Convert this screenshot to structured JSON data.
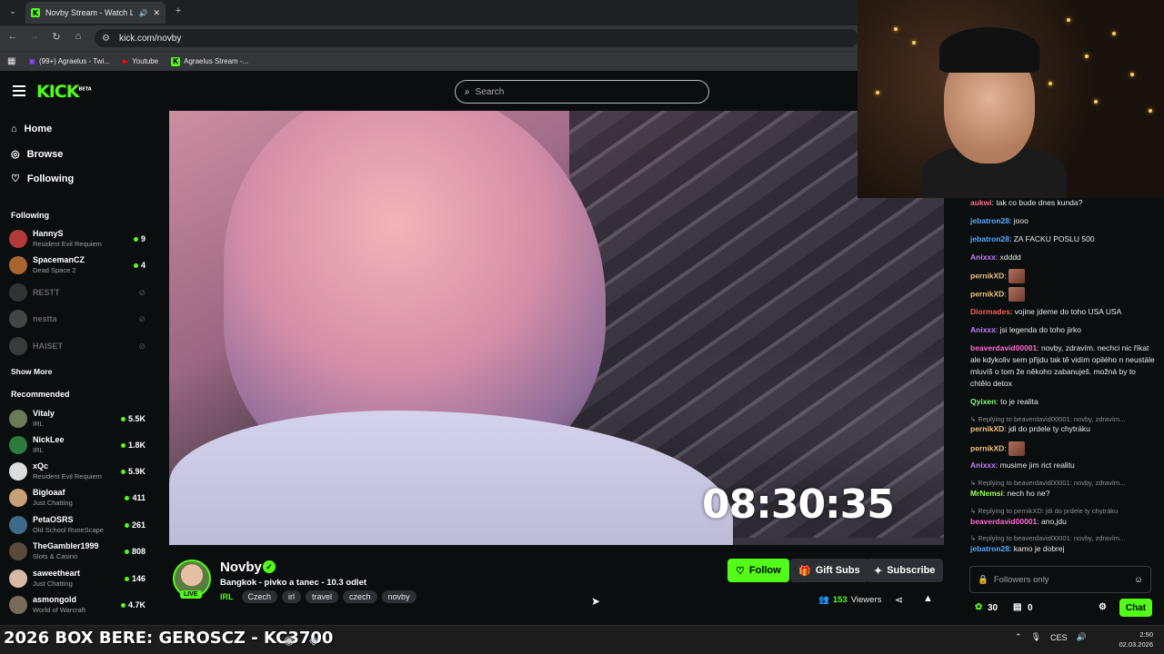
{
  "browser": {
    "tab_title": "Novby Stream - Watch Live",
    "url": "kick.com/novby",
    "bookmarks": [
      {
        "label": "(99+) Agraelus - Twi..."
      },
      {
        "label": "Youtube"
      },
      {
        "label": "Agraelus Stream -..."
      }
    ]
  },
  "header": {
    "logo": "KICK",
    "logo_badge": "BETA",
    "search_placeholder": "Search"
  },
  "sidebar": {
    "nav": [
      {
        "label": "Home",
        "icon": "home-icon"
      },
      {
        "label": "Browse",
        "icon": "compass-icon"
      },
      {
        "label": "Following",
        "icon": "heart-icon"
      }
    ],
    "following_heading": "Following",
    "following": [
      {
        "name": "HannyS",
        "category": "Resident Evil Requiem",
        "viewers": "9",
        "live": true
      },
      {
        "name": "SpacemanCZ",
        "category": "Dead Space 2",
        "viewers": "4",
        "live": true
      },
      {
        "name": "RESTT",
        "category": "",
        "viewers": "",
        "live": false
      },
      {
        "name": "nestta",
        "category": "",
        "viewers": "",
        "live": false
      },
      {
        "name": "HAISET",
        "category": "",
        "viewers": "",
        "live": false
      }
    ],
    "show_more": "Show More",
    "recommended_heading": "Recommended",
    "recommended": [
      {
        "name": "Vitaly",
        "category": "IRL",
        "viewers": "5.5K"
      },
      {
        "name": "NickLee",
        "category": "IRL",
        "viewers": "1.8K"
      },
      {
        "name": "xQc",
        "category": "Resident Evil Requiem",
        "viewers": "5.9K"
      },
      {
        "name": "Bigloaaf",
        "category": "Just Chatting",
        "viewers": "411"
      },
      {
        "name": "PetaOSRS",
        "category": "Old School RuneScape",
        "viewers": "261"
      },
      {
        "name": "TheGambler1999",
        "category": "Slots & Casino",
        "viewers": "808"
      },
      {
        "name": "saweetheart",
        "category": "Just Chatting",
        "viewers": "146"
      },
      {
        "name": "asmongold",
        "category": "World of Warcraft",
        "viewers": "4.7K"
      }
    ]
  },
  "video": {
    "timer": "08:30:35"
  },
  "channel": {
    "name": "Novby",
    "live_badge": "LIVE",
    "stream_title": "Bangkok - pivko a tanec - 10.3 odlet",
    "category": "IRL",
    "tags": [
      "Czech",
      "irl",
      "travel",
      "czech",
      "novby"
    ],
    "viewers": "153",
    "viewers_label": "Viewers",
    "follow_label": "Follow",
    "gift_label": "Gift Subs",
    "subscribe_label": "Subscribe"
  },
  "chat": {
    "messages": [
      {
        "user": "aukwi",
        "color": "#ff6b8a",
        "text": "tak co bude dnes kunda?"
      },
      {
        "user": "jebatron28",
        "color": "#5aa9ff",
        "text": "jooo"
      },
      {
        "user": "jebatron28",
        "color": "#5aa9ff",
        "text": "ZA FACKU POSLU 500"
      },
      {
        "user": "Anixxx",
        "color": "#c77dff",
        "text": "xdddd"
      },
      {
        "user": "pernikXD",
        "color": "#f0c27b",
        "text": ""
      },
      {
        "user": "pernikXD",
        "color": "#f0c27b",
        "text": ""
      },
      {
        "user": "Diormades",
        "color": "#ff5c5c",
        "text": "vojine jdeme do toho USA USA"
      },
      {
        "user": "Anixxx",
        "color": "#c77dff",
        "text": "jsi legenda do toho jirko"
      },
      {
        "user": "beaverdavid00001",
        "color": "#ff6bd5",
        "text": "novby, zdravím. nechci nic říkat ale kdykoliv sem přijdu tak tě vidím opilého n neustále mluvíš o tom že někoho zabanuješ. možná by to chtělo detox"
      },
      {
        "user": "Qyixen",
        "color": "#7cff7c",
        "text": "to je realita"
      },
      {
        "reply": "Replying to beaverdavid00001: novby, zdravím...",
        "user": "pernikXD",
        "color": "#f0c27b",
        "text": "jdi do prdele ty chytráku"
      },
      {
        "user": "pernikXD",
        "color": "#f0c27b",
        "text": ""
      },
      {
        "user": "Anixxx",
        "color": "#c77dff",
        "text": "musime jim rict realitu"
      },
      {
        "reply": "Replying to beaverdavid00001: novby, zdravím...",
        "user": "MrNemsi",
        "color": "#9cff57",
        "text": "nech ho ne?"
      },
      {
        "reply": "Replying to pernikXD: jdi do prdele ty chytráku",
        "user": "beaverdavid00001",
        "color": "#ff6bd5",
        "text": "ano,jdu"
      },
      {
        "reply": "Replying to beaverdavid00001: novby, zdravím...",
        "user": "jebatron28",
        "color": "#5aa9ff",
        "text": "kamo je dobrej"
      }
    ],
    "input_placeholder": "Followers only",
    "points": "30",
    "chest_count": "0",
    "chat_button": "Chat"
  },
  "taskbar": {
    "ticker": "2026 BOX BERE: GEROSCZ - KC3700",
    "language": "CES",
    "time": "2:50",
    "date": "02.03.2026"
  },
  "colors": {
    "accent": "#53fc18",
    "background": "#0b0e0f",
    "button_secondary": "#2c2f33"
  }
}
